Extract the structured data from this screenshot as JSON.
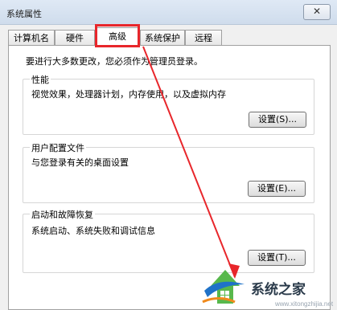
{
  "window": {
    "title": "系统属性",
    "close_glyph": "✕"
  },
  "tabs": [
    {
      "label": "计算机名"
    },
    {
      "label": "硬件"
    },
    {
      "label": "高级",
      "active": true
    },
    {
      "label": "系统保护"
    },
    {
      "label": "远程"
    }
  ],
  "advanced": {
    "notice": "要进行大多数更改，您必须作为管理员登录。",
    "performance": {
      "title": "性能",
      "description": "视觉效果，处理器计划，内存使用，以及虚拟内存",
      "button": "设置(S)..."
    },
    "user_profiles": {
      "title": "用户配置文件",
      "description": "与您登录有关的桌面设置",
      "button": "设置(E)..."
    },
    "startup_recovery": {
      "title": "启动和故障恢复",
      "description": "系统启动、系统失败和调试信息",
      "button": "设置(T)..."
    }
  },
  "watermark": {
    "brand": "系统之家",
    "url": "www.xitongzhijia.net"
  },
  "colors": {
    "annotation_red": "#e8262b",
    "window_bg": "#f0f0f0"
  }
}
